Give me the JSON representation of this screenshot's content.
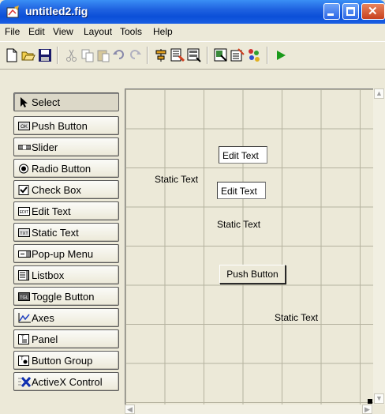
{
  "window": {
    "title": "untitled2.fig"
  },
  "menu": [
    "File",
    "Edit",
    "View",
    "Layout",
    "Tools",
    "Help"
  ],
  "toolbar": {
    "buttons": [
      "new-icon",
      "open-icon",
      "save-icon",
      "cut-icon",
      "copy-icon",
      "paste-icon",
      "undo-icon",
      "redo-icon",
      "align-icon",
      "menu-editor-icon",
      "tab-order-icon",
      "m-file-editor-icon",
      "property-inspector-icon",
      "object-browser-icon",
      "run-icon"
    ]
  },
  "palette": [
    {
      "label": "Select",
      "icon": "arrow-cursor-icon",
      "selected": true
    },
    {
      "label": "Push Button",
      "icon": "push-button-icon"
    },
    {
      "label": "Slider",
      "icon": "slider-icon"
    },
    {
      "label": "Radio Button",
      "icon": "radio-button-icon"
    },
    {
      "label": "Check Box",
      "icon": "check-box-icon"
    },
    {
      "label": "Edit Text",
      "icon": "edit-text-icon"
    },
    {
      "label": "Static Text",
      "icon": "static-text-icon"
    },
    {
      "label": "Pop-up Menu",
      "icon": "popup-menu-icon"
    },
    {
      "label": "Listbox",
      "icon": "listbox-icon"
    },
    {
      "label": "Toggle Button",
      "icon": "toggle-button-icon"
    },
    {
      "label": "Axes",
      "icon": "axes-icon"
    },
    {
      "label": "Panel",
      "icon": "panel-icon"
    },
    {
      "label": "Button Group",
      "icon": "button-group-icon"
    },
    {
      "label": "ActiveX Control",
      "icon": "activex-icon"
    }
  ],
  "palette_icon_text": {
    "push": "OK",
    "edit": "EDIT",
    "static": "TXT",
    "toggle": "TGL",
    "panel": "T"
  },
  "canvas": {
    "edit_text_1": "Edit Text",
    "edit_text_2": "Edit Text",
    "static_text_1": "Static Text",
    "static_text_2": "Static Text",
    "static_text_3": "Static Text",
    "push_button": "Push Button"
  },
  "colors": {
    "titlebar": "#0b4fd8",
    "chrome": "#ece9d8",
    "grid": "#b5b29f"
  }
}
